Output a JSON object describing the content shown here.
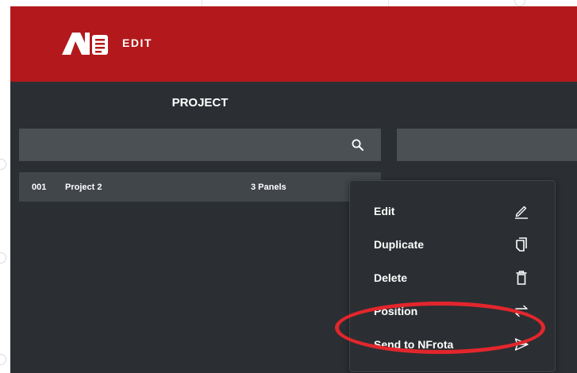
{
  "header": {
    "app_label": "EDIT"
  },
  "project_list": {
    "section_title": "PROJECT",
    "rows": [
      {
        "number": "001",
        "name": "Project 2",
        "panels": "3 Panels"
      }
    ]
  },
  "context_menu": {
    "items": [
      {
        "label": "Edit",
        "icon": "pencil-icon"
      },
      {
        "label": "Duplicate",
        "icon": "copy-icon"
      },
      {
        "label": "Delete",
        "icon": "trash-icon"
      },
      {
        "label": "Position",
        "icon": "swap-arrows-icon"
      },
      {
        "label": "Send to NFrota",
        "icon": "send-icon"
      }
    ]
  },
  "colors": {
    "header_red": "#b3191c",
    "app_background": "#2b2f33",
    "bar_grey": "#4b5055",
    "row_grey": "#41464b",
    "highlight_circle": "#e3262c"
  }
}
